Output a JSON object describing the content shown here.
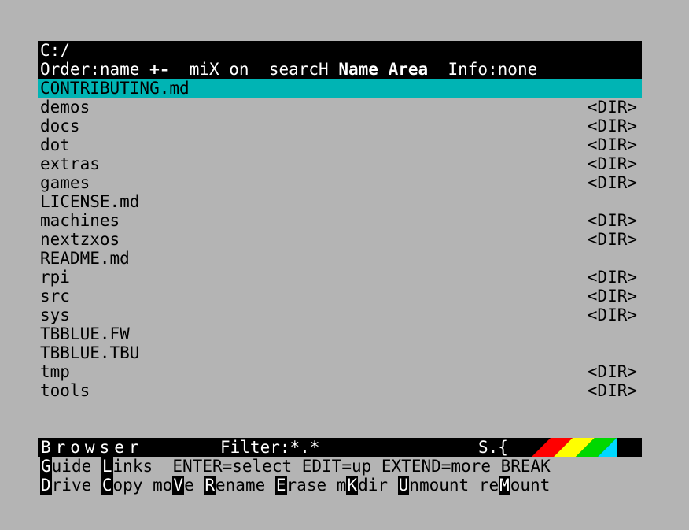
{
  "header": {
    "path": "C:/",
    "order": "Order:name",
    "sort_sign": "+-",
    "mix": "miX on",
    "search": "searcH",
    "name_area": "Name Area",
    "info": "Info:none"
  },
  "files": [
    {
      "name": "CONTRIBUTING.md",
      "tag": "",
      "selected": true
    },
    {
      "name": "demos",
      "tag": "<DIR>"
    },
    {
      "name": "docs",
      "tag": "<DIR>"
    },
    {
      "name": "dot",
      "tag": "<DIR>"
    },
    {
      "name": "extras",
      "tag": "<DIR>"
    },
    {
      "name": "games",
      "tag": "<DIR>"
    },
    {
      "name": "LICENSE.md",
      "tag": ""
    },
    {
      "name": "machines",
      "tag": "<DIR>"
    },
    {
      "name": "nextzxos",
      "tag": "<DIR>"
    },
    {
      "name": "README.md",
      "tag": ""
    },
    {
      "name": "rpi",
      "tag": "<DIR>"
    },
    {
      "name": "src",
      "tag": "<DIR>"
    },
    {
      "name": "sys",
      "tag": "<DIR>"
    },
    {
      "name": "TBBLUE.FW",
      "tag": ""
    },
    {
      "name": "TBBLUE.TBU",
      "tag": ""
    },
    {
      "name": "tmp",
      "tag": "<DIR>"
    },
    {
      "name": "tools",
      "tag": "<DIR>"
    }
  ],
  "footer": {
    "title": "Browser",
    "filter": "Filter:*.*",
    "status": "S.{"
  },
  "keys_line1": [
    {
      "key": "G",
      "rest": "uide "
    },
    {
      "key": "L",
      "rest": "inks  ENTER=select EDIT=up EXTEND=more BREAK"
    }
  ],
  "keys_line2": [
    {
      "pre": "",
      "key": "D",
      "rest": "rive "
    },
    {
      "pre": "",
      "key": "C",
      "rest": "opy "
    },
    {
      "pre": "mo",
      "key": "V",
      "rest": "e "
    },
    {
      "pre": "",
      "key": "R",
      "rest": "ename "
    },
    {
      "pre": "",
      "key": "E",
      "rest": "rase "
    },
    {
      "pre": "m",
      "key": "K",
      "rest": "dir "
    },
    {
      "pre": "",
      "key": "U",
      "rest": "nmount "
    },
    {
      "pre": "re",
      "key": "M",
      "rest": "ount"
    }
  ],
  "colors": {
    "background": "#b4b4b4",
    "selection": "#00b4b4",
    "bar": "#000000",
    "stripe_red": "#ff0000",
    "stripe_yellow": "#ffff00",
    "stripe_green": "#00d800",
    "stripe_cyan": "#00d8ff"
  }
}
